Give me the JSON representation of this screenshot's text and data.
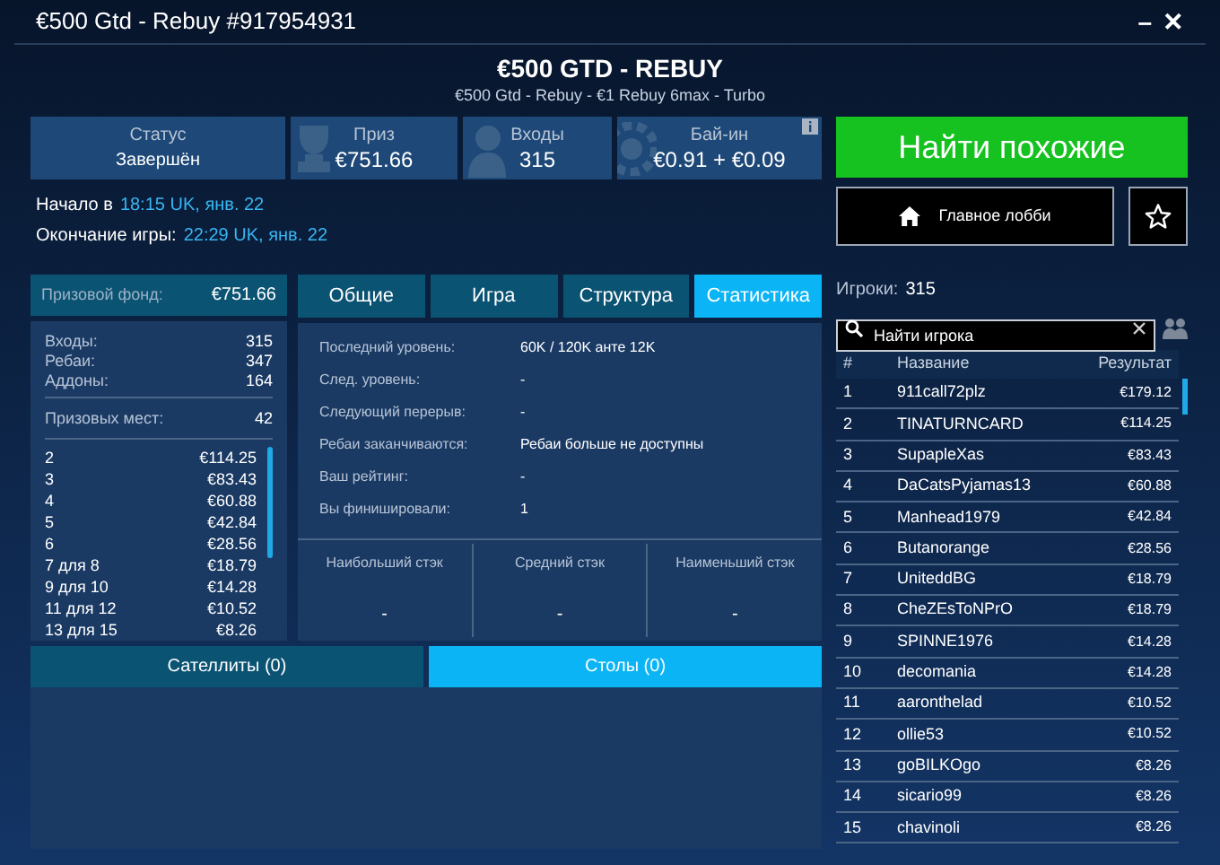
{
  "window": {
    "title": "€500 Gtd - Rebuy #917954931",
    "minimize": "–",
    "close": "✕"
  },
  "header": {
    "title": "€500 GTD - REBUY",
    "subtitle": "€500 Gtd - Rebuy - €1 Rebuy 6max - Turbo"
  },
  "info_boxes": [
    {
      "kind": "status",
      "label": "Статус",
      "value": "Завершён"
    },
    {
      "kind": "prize",
      "label": "Приз",
      "value": "€751.66"
    },
    {
      "kind": "entries",
      "label": "Входы",
      "value": "315"
    },
    {
      "kind": "buyin",
      "label": "Бай-ин",
      "value": "€0.91 + €0.09"
    }
  ],
  "find_similar_button": "Найти похожие",
  "lobby_button": "Главное лобби",
  "times": [
    {
      "label": "Начало в",
      "value": "18:15 UK, янв. 22"
    },
    {
      "label": "Окончание игры:",
      "value": "22:29 UK, янв. 22"
    }
  ],
  "prize_pool": {
    "label": "Призовой фонд:",
    "value": "€751.66"
  },
  "counts": [
    {
      "label": "Входы:",
      "value": "315"
    },
    {
      "label": "Ребаи:",
      "value": "347"
    },
    {
      "label": "Аддоны:",
      "value": "164"
    }
  ],
  "places": {
    "label": "Призовых мест:",
    "value": "42"
  },
  "payouts": [
    {
      "place": "2",
      "amount": "€114.25"
    },
    {
      "place": "3",
      "amount": "€83.43"
    },
    {
      "place": "4",
      "amount": "€60.88"
    },
    {
      "place": "5",
      "amount": "€42.84"
    },
    {
      "place": "6",
      "amount": "€28.56"
    },
    {
      "place": "7 для 8",
      "amount": "€18.79"
    },
    {
      "place": "9 для 10",
      "amount": "€14.28"
    },
    {
      "place": "11 для 12",
      "amount": "€10.52"
    },
    {
      "place": "13 для 15",
      "amount": "€8.26"
    }
  ],
  "tabs": [
    {
      "label": "Общие",
      "selected": false
    },
    {
      "label": "Игра",
      "selected": false
    },
    {
      "label": "Структура",
      "selected": false
    },
    {
      "label": "Статистика",
      "selected": true
    }
  ],
  "stats": [
    {
      "label": "Последний уровень:",
      "value": "60K / 120K анте 12K"
    },
    {
      "label": "След. уровень:",
      "value": "-"
    },
    {
      "label": "Следующий перерыв:",
      "value": "-"
    },
    {
      "label": "Ребаи заканчиваются:",
      "value": "Ребаи больше не доступны"
    },
    {
      "label": "Ваш рейтинг:",
      "value": "-"
    },
    {
      "label": "Вы финишировали:",
      "value": "1"
    }
  ],
  "stacks": [
    {
      "label": "Наибольший стэк",
      "value": "-"
    },
    {
      "label": "Средний стэк",
      "value": "-"
    },
    {
      "label": "Наименьший стэк",
      "value": "-"
    }
  ],
  "bottom_tabs": [
    {
      "label": "Сателлиты (0)",
      "selected": false
    },
    {
      "label": "Столы (0)",
      "selected": true
    }
  ],
  "players": {
    "label": "Игроки:",
    "count": "315",
    "search_placeholder": "Найти игрока",
    "columns": [
      "#",
      "Название",
      "Результат"
    ],
    "rows": [
      [
        "1",
        "911call72plz",
        "€179.12"
      ],
      [
        "2",
        "TINATURNCARD",
        "€114.25"
      ],
      [
        "3",
        "SupapleXas",
        "€83.43"
      ],
      [
        "4",
        "DaCatsPyjamas13",
        "€60.88"
      ],
      [
        "5",
        "Manhead1979",
        "€42.84"
      ],
      [
        "6",
        "Butanorange",
        "€28.56"
      ],
      [
        "7",
        "UniteddBG",
        "€18.79"
      ],
      [
        "8",
        "CheZEsToNPrO",
        "€18.79"
      ],
      [
        "9",
        "SPINNE1976",
        "€14.28"
      ],
      [
        "10",
        "decomania",
        "€14.28"
      ],
      [
        "11",
        "aaronthelad",
        "€10.52"
      ],
      [
        "12",
        "ollie53",
        "€10.52"
      ],
      [
        "13",
        "goBILKOgo",
        "€8.26"
      ],
      [
        "14",
        "sicario99",
        "€8.26"
      ],
      [
        "15",
        "chavinoli",
        "€8.26"
      ]
    ]
  }
}
